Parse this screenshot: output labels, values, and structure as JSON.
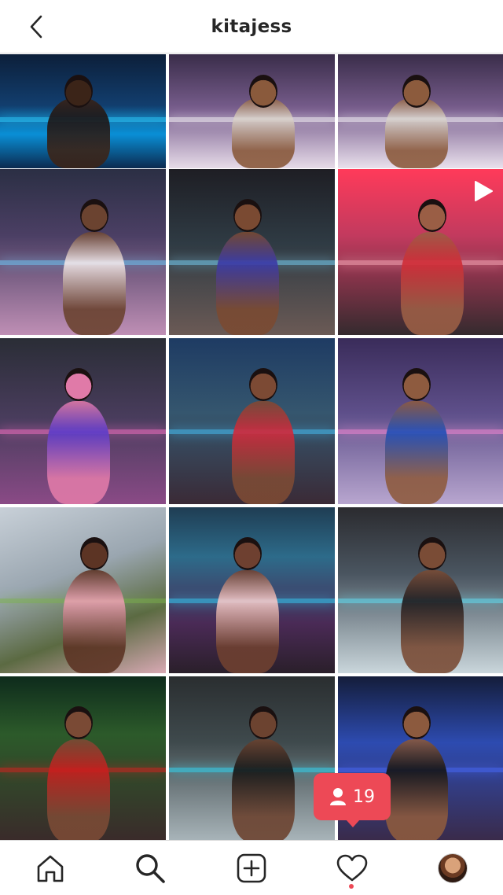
{
  "header": {
    "title": "kitajess"
  },
  "grid": {
    "tiles": [
      {
        "bg": "linear-gradient(180deg,#0c1f3a 0%,#123e6e 45%,#0a8fd6 70%,#0b2a4f 100%)",
        "accent": "#2fd0ff",
        "figure": "#1b1414",
        "skin": "#3b2418",
        "type": "photo"
      },
      {
        "bg": "linear-gradient(180deg,#3a2d4a 0%,#7a5f8f 50%,#e6dbe8 100%)",
        "accent": "#ffffff",
        "figure": "#d9d2cc",
        "skin": "#8a5a3c",
        "type": "photo"
      },
      {
        "bg": "linear-gradient(180deg,#3a2d4a 0%,#7a5f8f 50%,#e9e0ec 100%)",
        "accent": "#ffffff",
        "figure": "#d8d3cf",
        "skin": "#8c5b3d",
        "type": "photo"
      },
      {
        "bg": "linear-gradient(180deg,#2b2f44 0%,#4b3f64 40%,#bf8fb5 100%)",
        "accent": "#6fd0ff",
        "figure": "#f1e7ea",
        "skin": "#6b4330",
        "type": "photo"
      },
      {
        "bg": "linear-gradient(180deg,#1e1e24 0%,#2f3b44 45%,#6b5a55 100%)",
        "accent": "#7ad8ff",
        "figure": "#3a39a8",
        "skin": "#7a4a32",
        "type": "photo"
      },
      {
        "bg": "linear-gradient(180deg,#ff3a5a 0%,#c23a5e 40%,#342a2e 100%)",
        "accent": "#ffb3c0",
        "figure": "#d12b36",
        "skin": "#9a5e45",
        "type": "video"
      },
      {
        "bg": "linear-gradient(180deg,#2a2d36 0%,#4a3d5e 50%,#8a4a86 100%)",
        "accent": "#ff72c8",
        "figure": "#5a3bc9",
        "skin": "#e07aa8",
        "type": "photo"
      },
      {
        "bg": "linear-gradient(180deg,#1e3b63 0%,#35566e 45%,#3a2a36 100%)",
        "accent": "#47c8ff",
        "figure": "#d2283b",
        "skin": "#7c4a34",
        "type": "photo"
      },
      {
        "bg": "linear-gradient(180deg,#3a2c5a 0%,#5e4f8a 45%,#b8a6cf 100%)",
        "accent": "#ff8ad8",
        "figure": "#1f4fb8",
        "skin": "#8e5b3f",
        "type": "photo"
      },
      {
        "bg": "linear-gradient(160deg,#c8d0d8 0%,#9aa6b0 40%,#5b6a42 70%,#d8a9b4 100%)",
        "accent": "#7bb34a",
        "figure": "#e8a0b0",
        "skin": "#5c3424",
        "type": "photo"
      },
      {
        "bg": "linear-gradient(180deg,#1f3d53 0%,#2d6b8a 30%,#4a2a56 70%,#2a1f2a 100%)",
        "accent": "#33d6ff",
        "figure": "#f3c7c8",
        "skin": "#6e4030",
        "type": "photo"
      },
      {
        "bg": "linear-gradient(180deg,#2b2b2f 0%,#4a5560 40%,#c9d6db 100%)",
        "accent": "#5fe8ff",
        "figure": "#1d1a1d",
        "skin": "#7a4c36",
        "type": "photo"
      },
      {
        "bg": "linear-gradient(180deg,#0e2b1c 0%,#2c5a2a 35%,#3a2a2a 100%)",
        "accent": "#e21e1e",
        "figure": "#c81e1e",
        "skin": "#7a4a35",
        "type": "photo"
      },
      {
        "bg": "linear-gradient(180deg,#2a2e30 0%,#3f4a4d 40%,#aab6bb 100%)",
        "accent": "#2ee0ff",
        "figure": "#151515",
        "skin": "#6c4330",
        "type": "photo"
      },
      {
        "bg": "linear-gradient(180deg,#141d3a 0%,#2d4bb0 40%,#3a2a48 100%)",
        "accent": "#4a6aff",
        "figure": "#141414",
        "skin": "#8c5a3e",
        "type": "photo"
      }
    ]
  },
  "notification": {
    "count": "19",
    "icon": "person-icon",
    "color": "#ed4956"
  },
  "tabbar": {
    "items": [
      {
        "name": "home",
        "icon": "home-icon"
      },
      {
        "name": "search",
        "icon": "search-icon"
      },
      {
        "name": "new-post",
        "icon": "plus-square-icon"
      },
      {
        "name": "activity",
        "icon": "heart-icon"
      },
      {
        "name": "profile",
        "icon": "avatar"
      }
    ]
  }
}
